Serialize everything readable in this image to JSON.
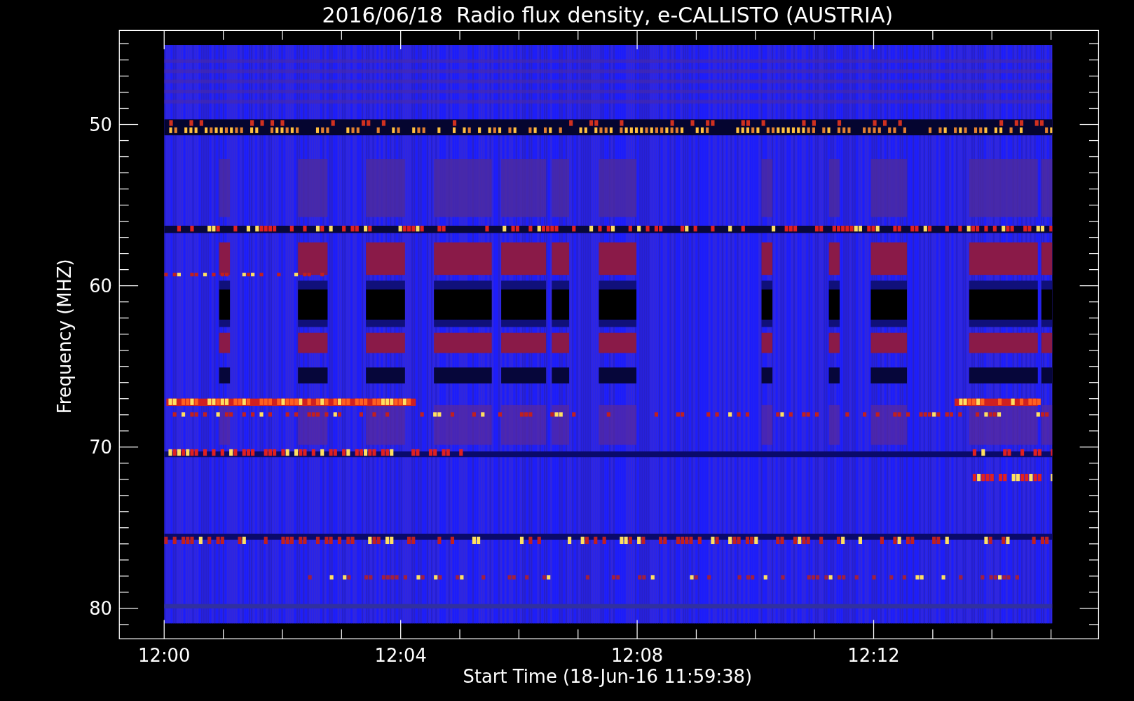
{
  "title": "2016/06/18  Radio flux density, e-CALLISTO (AUSTRIA)",
  "y_axis": {
    "label": "Frequency (MHZ)",
    "ticks": [
      "50",
      "60",
      "70",
      "80"
    ]
  },
  "x_axis": {
    "label": "Start Time (18-Jun-16 11:59:38)",
    "ticks": [
      "12:00",
      "12:04",
      "12:08",
      "12:12"
    ]
  }
}
